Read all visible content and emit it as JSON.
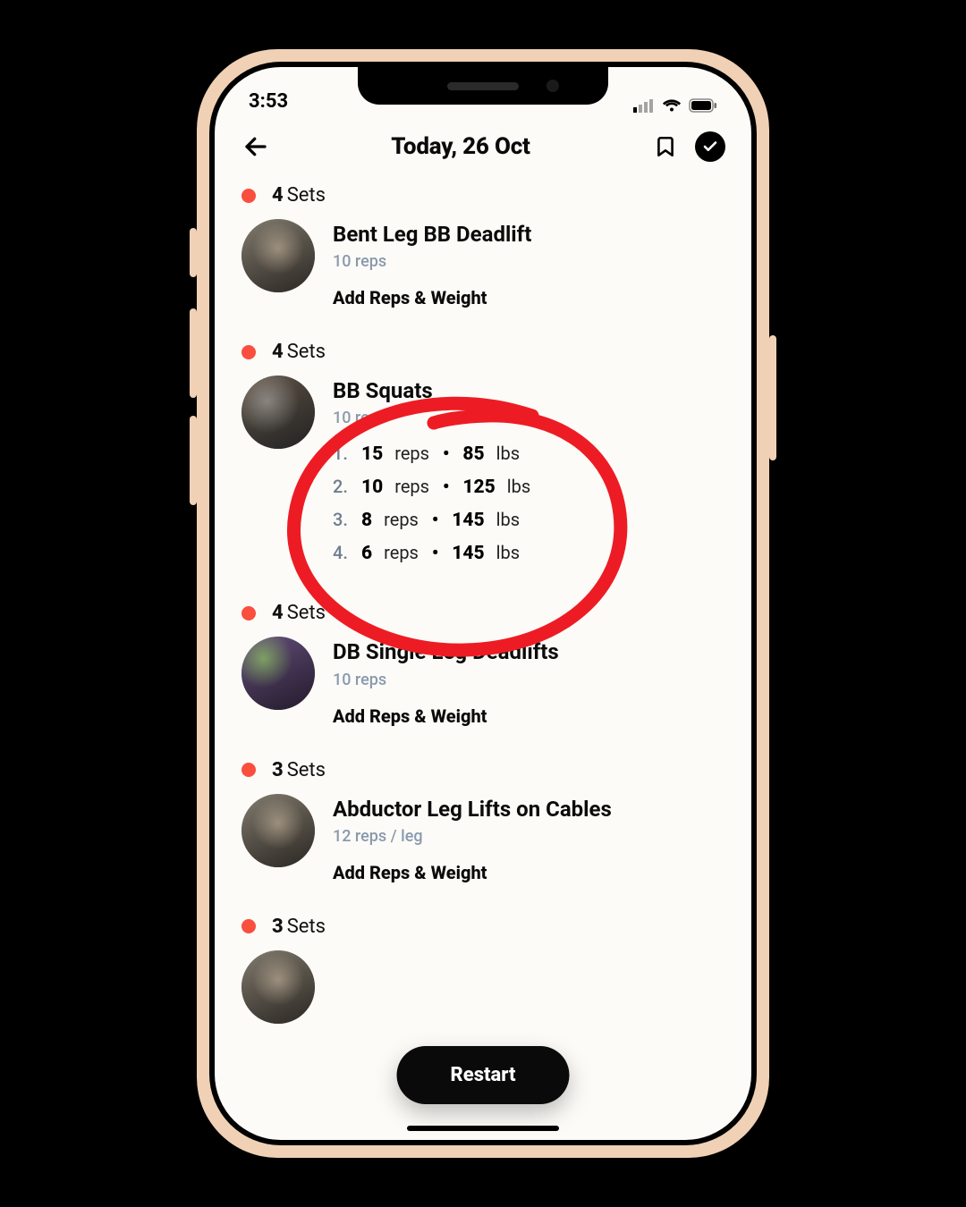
{
  "statusbar": {
    "time": "3:53"
  },
  "header": {
    "title": "Today, 26 Oct"
  },
  "restart_label": "Restart",
  "sets_word": "Sets",
  "reps_word": "reps",
  "lbs_word": "lbs",
  "add_link_label": "Add Reps & Weight",
  "exercises": [
    {
      "sets_count": "4",
      "name": "Bent Leg BB Deadlift",
      "subtext": "10 reps",
      "has_log": false
    },
    {
      "sets_count": "4",
      "name": "BB Squats",
      "subtext": "10 reps",
      "has_log": true,
      "log": [
        {
          "n": "1.",
          "reps": "15",
          "weight": "85"
        },
        {
          "n": "2.",
          "reps": "10",
          "weight": "125"
        },
        {
          "n": "3.",
          "reps": "8",
          "weight": "145"
        },
        {
          "n": "4.",
          "reps": "6",
          "weight": "145"
        }
      ]
    },
    {
      "sets_count": "4",
      "name": "DB Single Leg Deadlifts",
      "subtext": "10 reps",
      "has_log": false
    },
    {
      "sets_count": "3",
      "name": "Abductor Leg Lifts on Cables",
      "subtext": "12 reps / leg",
      "has_log": false
    },
    {
      "sets_count": "3",
      "name": "",
      "subtext": "",
      "has_log": false
    }
  ]
}
